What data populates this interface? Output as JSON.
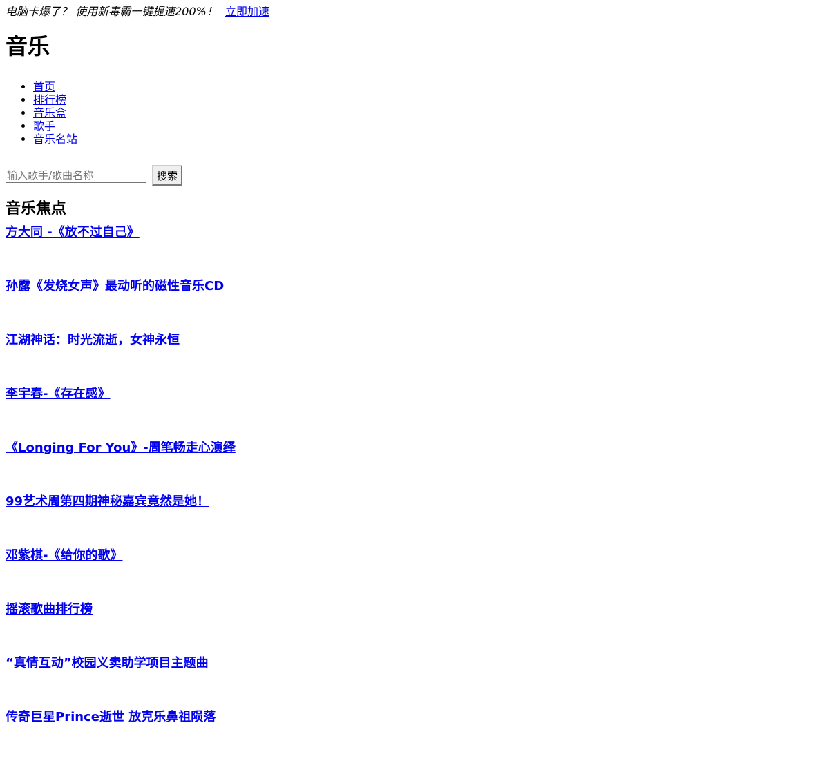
{
  "promo": {
    "text": "电脑卡爆了？ 使用新毒霸一键提速200%！",
    "link": "立即加速"
  },
  "site_title": "音乐",
  "nav": {
    "items": [
      {
        "label": "首页"
      },
      {
        "label": "排行榜"
      },
      {
        "label": "音乐盒"
      },
      {
        "label": "歌手"
      },
      {
        "label": "音乐名站"
      }
    ]
  },
  "search": {
    "placeholder": "输入歌手/歌曲名称",
    "button_label": "搜索"
  },
  "focus": {
    "heading": "音乐焦点",
    "items": [
      {
        "title": "方大同 -《放不过自己》 "
      },
      {
        "title": "孙露《发烧女声》最动听的磁性音乐CD"
      },
      {
        "title": "江湖神话：时光流逝，女神永恒"
      },
      {
        "title": "李宇春-《存在感》 "
      },
      {
        "title": " 《Longing For You》-周笔畅走心演绎"
      },
      {
        "title": "99艺术周第四期神秘嘉宾竟然是她！ "
      },
      {
        "title": "邓紫棋-《给你的歌》 "
      },
      {
        "title": "摇滚歌曲排行榜"
      },
      {
        "title": "“真情互动”校园义卖助学项目主题曲"
      },
      {
        "title": "传奇巨星Prince逝世 放克乐鼻祖陨落"
      }
    ]
  }
}
